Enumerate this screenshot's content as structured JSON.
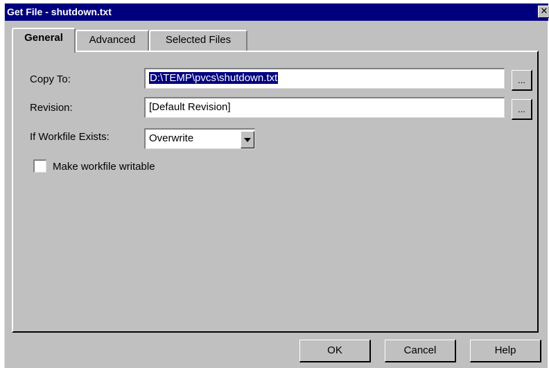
{
  "window": {
    "title": "Get File - shutdown.txt",
    "close_label": "✕"
  },
  "tabs": [
    {
      "label": "General",
      "active": true
    },
    {
      "label": "Advanced",
      "active": false
    },
    {
      "label": "Selected Files",
      "active": false
    }
  ],
  "form": {
    "copy_to": {
      "label": "Copy To:",
      "value": "D:\\TEMP\\pvcs\\shutdown.txt",
      "browse_label": "..."
    },
    "revision": {
      "label": "Revision:",
      "value": "[Default Revision]",
      "browse_label": "..."
    },
    "if_workfile_exists": {
      "label": "If Workfile Exists:",
      "selected": "Overwrite"
    },
    "make_writable": {
      "label": "Make workfile writable",
      "checked": false
    }
  },
  "buttons": {
    "ok": "OK",
    "cancel": "Cancel",
    "help": "Help"
  },
  "colors": {
    "titlebar": "#00007f",
    "face": "#c0c0c0",
    "selection": "#00007f"
  }
}
